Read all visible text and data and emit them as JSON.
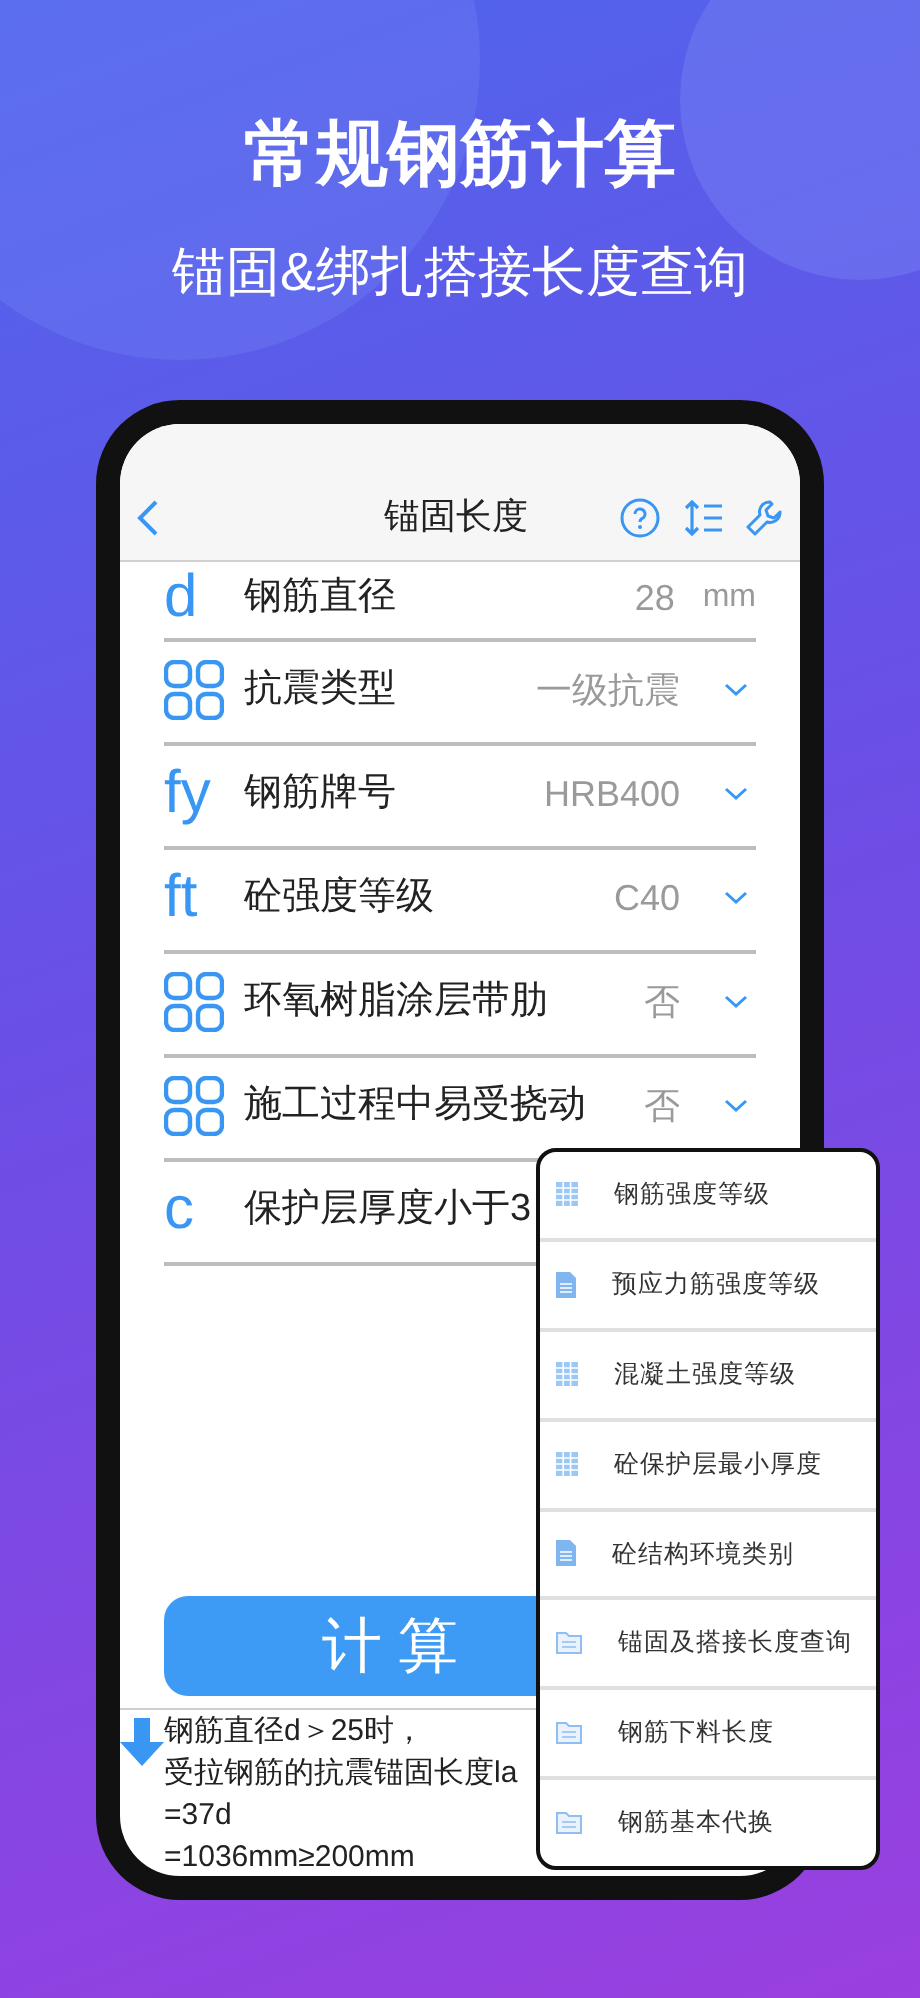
{
  "headline": "常规钢筋计算",
  "subheadline": "锚固&绑扎搭接长度查询",
  "nav": {
    "title": "锚固长度"
  },
  "rows": [
    {
      "kind": "input",
      "symbol": "d",
      "label": "钢筋直径",
      "value": "28",
      "unit": "mm"
    },
    {
      "kind": "select",
      "label": "抗震类型",
      "value": "一级抗震"
    },
    {
      "kind": "select",
      "symbol": "fy",
      "label": "钢筋牌号",
      "value": "HRB400"
    },
    {
      "kind": "select",
      "symbol": "ft",
      "label": "砼强度等级",
      "value": "C40"
    },
    {
      "kind": "select",
      "label": "环氧树脂涂层带肋",
      "value": "否"
    },
    {
      "kind": "select",
      "label": "施工过程中易受挠动",
      "value": "否"
    },
    {
      "kind": "input",
      "symbol": "c",
      "label": "保护层厚度小于3"
    }
  ],
  "calculate_button": "计 算",
  "result_lines": [
    "钢筋直径d＞25时，",
    "受拉钢筋的抗震锚固长度la",
    "=37d",
    "=1036mm≥200mm"
  ],
  "menu": [
    {
      "kind": "table",
      "label": "钢筋强度等级"
    },
    {
      "kind": "document",
      "label": "预应力筋强度等级"
    },
    {
      "kind": "table",
      "label": "混凝土强度等级"
    },
    {
      "kind": "table",
      "label": "砼保护层最小厚度"
    },
    {
      "kind": "document",
      "label": "砼结构环境类别"
    },
    {
      "kind": "folder",
      "label": "锚固及搭接长度查询"
    },
    {
      "kind": "folder",
      "label": "钢筋下料长度"
    },
    {
      "kind": "folder",
      "label": "钢筋基本代换"
    }
  ]
}
